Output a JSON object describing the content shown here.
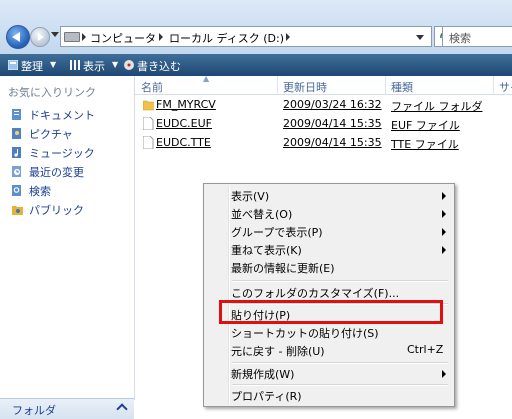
{
  "address": {
    "breadcrumbs": [
      "コンピュータ",
      "ローカル ディスク (D:)"
    ],
    "search_placeholder": "検索"
  },
  "toolbar": {
    "organize": "整理",
    "views": "表示",
    "burn": "書き込む"
  },
  "sidebar": {
    "favorites_label": "お気に入りリンク",
    "items": [
      {
        "label": "ドキュメント",
        "icon": "documents-icon"
      },
      {
        "label": "ピクチャ",
        "icon": "pictures-icon"
      },
      {
        "label": "ミュージック",
        "icon": "music-icon"
      },
      {
        "label": "最近の変更",
        "icon": "recent-changes-icon"
      },
      {
        "label": "検索",
        "icon": "search-folder-icon"
      },
      {
        "label": "パブリック",
        "icon": "public-folder-icon"
      }
    ],
    "folders_label": "フォルダ"
  },
  "columns": [
    "名前",
    "更新日時",
    "種類",
    "サイ"
  ],
  "files": [
    {
      "name": "FM_MYRCV",
      "modified": "2009/03/24 16:32",
      "type": "ファイル フォルダ",
      "icon": "folder-icon"
    },
    {
      "name": "EUDC.EUF",
      "modified": "2009/04/14 15:35",
      "type": "EUF ファイル",
      "icon": "file-icon"
    },
    {
      "name": "EUDC.TTE",
      "modified": "2009/04/14 15:35",
      "type": "TTE ファイル",
      "icon": "file-icon"
    }
  ],
  "context_menu": {
    "view": "表示(V)",
    "sort_by": "並べ替え(O)",
    "group_by": "グループで表示(P)",
    "stack_by": "重ねて表示(K)",
    "refresh": "最新の情報に更新(E)",
    "customize": "このフォルダのカスタマイズ(F)...",
    "paste": "貼り付け(P)",
    "paste_shortcut": "ショートカットの貼り付け(S)",
    "undo_delete": "元に戻す - 削除(U)",
    "undo_shortcut": "Ctrl+Z",
    "new": "新規作成(W)",
    "properties": "プロパティ(R)"
  },
  "colors": {
    "highlight_border": "#e01010",
    "link_blue": "#1c3f94",
    "toolbar_bg": "#2a5580"
  }
}
